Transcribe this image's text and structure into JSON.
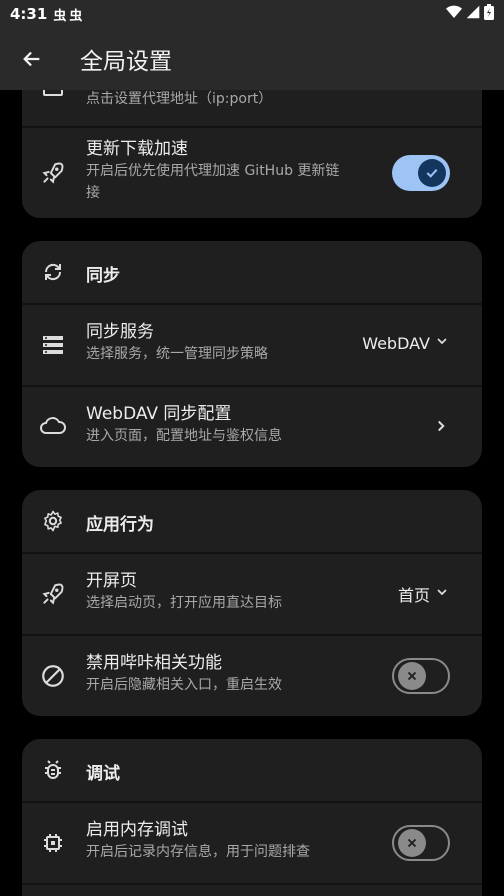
{
  "status": {
    "time": "4:31",
    "badges": [
      "虫",
      "虫"
    ]
  },
  "appbar": {
    "title": "全局设置",
    "back_icon": "arrow-back-icon"
  },
  "network": {
    "proxy_address": {
      "subtitle": "点击设置代理地址（ip:port）"
    },
    "update_accel": {
      "title": "更新下载加速",
      "subtitle_line1": "开启后优先使用代理加速 GitHub 更新链",
      "subtitle_line2": "接",
      "enabled": true
    }
  },
  "sync": {
    "header": "同步",
    "service": {
      "title": "同步服务",
      "subtitle": "选择服务，统一管理同步策略",
      "value": "WebDAV"
    },
    "webdav": {
      "title": "WebDAV 同步配置",
      "subtitle": "进入页面，配置地址与鉴权信息"
    }
  },
  "behavior": {
    "header": "应用行为",
    "launch_page": {
      "title": "开屏页",
      "subtitle": "选择启动页，打开应用直达目标",
      "value": "首页"
    },
    "disable_bili": {
      "title": "禁用哔咔相关功能",
      "subtitle": "开启后隐藏相关入口，重启生效",
      "enabled": false
    }
  },
  "debug": {
    "header": "调试",
    "memory_debug": {
      "title": "启用内存调试",
      "subtitle": "开启后记录内存信息，用于问题排查",
      "enabled": false
    }
  },
  "colors": {
    "accent": "#9ec3f5",
    "card": "#1f1f1f",
    "bar": "#2a2a2a"
  }
}
